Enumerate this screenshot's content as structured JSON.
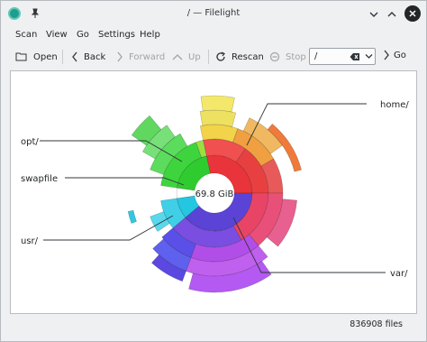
{
  "window": {
    "title": "/ — Filelight"
  },
  "menu": {
    "items": [
      {
        "label": "Scan"
      },
      {
        "label": "View"
      },
      {
        "label": "Go"
      },
      {
        "label": "Settings"
      },
      {
        "label": "Help"
      }
    ]
  },
  "toolbar": {
    "open_label": "Open",
    "back_label": "Back",
    "forward_label": "Forward",
    "up_label": "Up",
    "rescan_label": "Rescan",
    "stop_label": "Stop",
    "path_value": "/",
    "go_label": "Go"
  },
  "chart": {
    "center_label": "69.8 GiB",
    "labels": {
      "home": "home/",
      "opt": "opt/",
      "swapfile": "swapfile",
      "usr": "usr/",
      "var": "var/"
    },
    "colors": {
      "home": "#e8343a",
      "opt": "#2fcc2f",
      "swapfile": "#ffffff",
      "usr": "#24c6e0",
      "var": "#5b43d6"
    }
  },
  "status": {
    "files_count": "836908 files"
  }
}
